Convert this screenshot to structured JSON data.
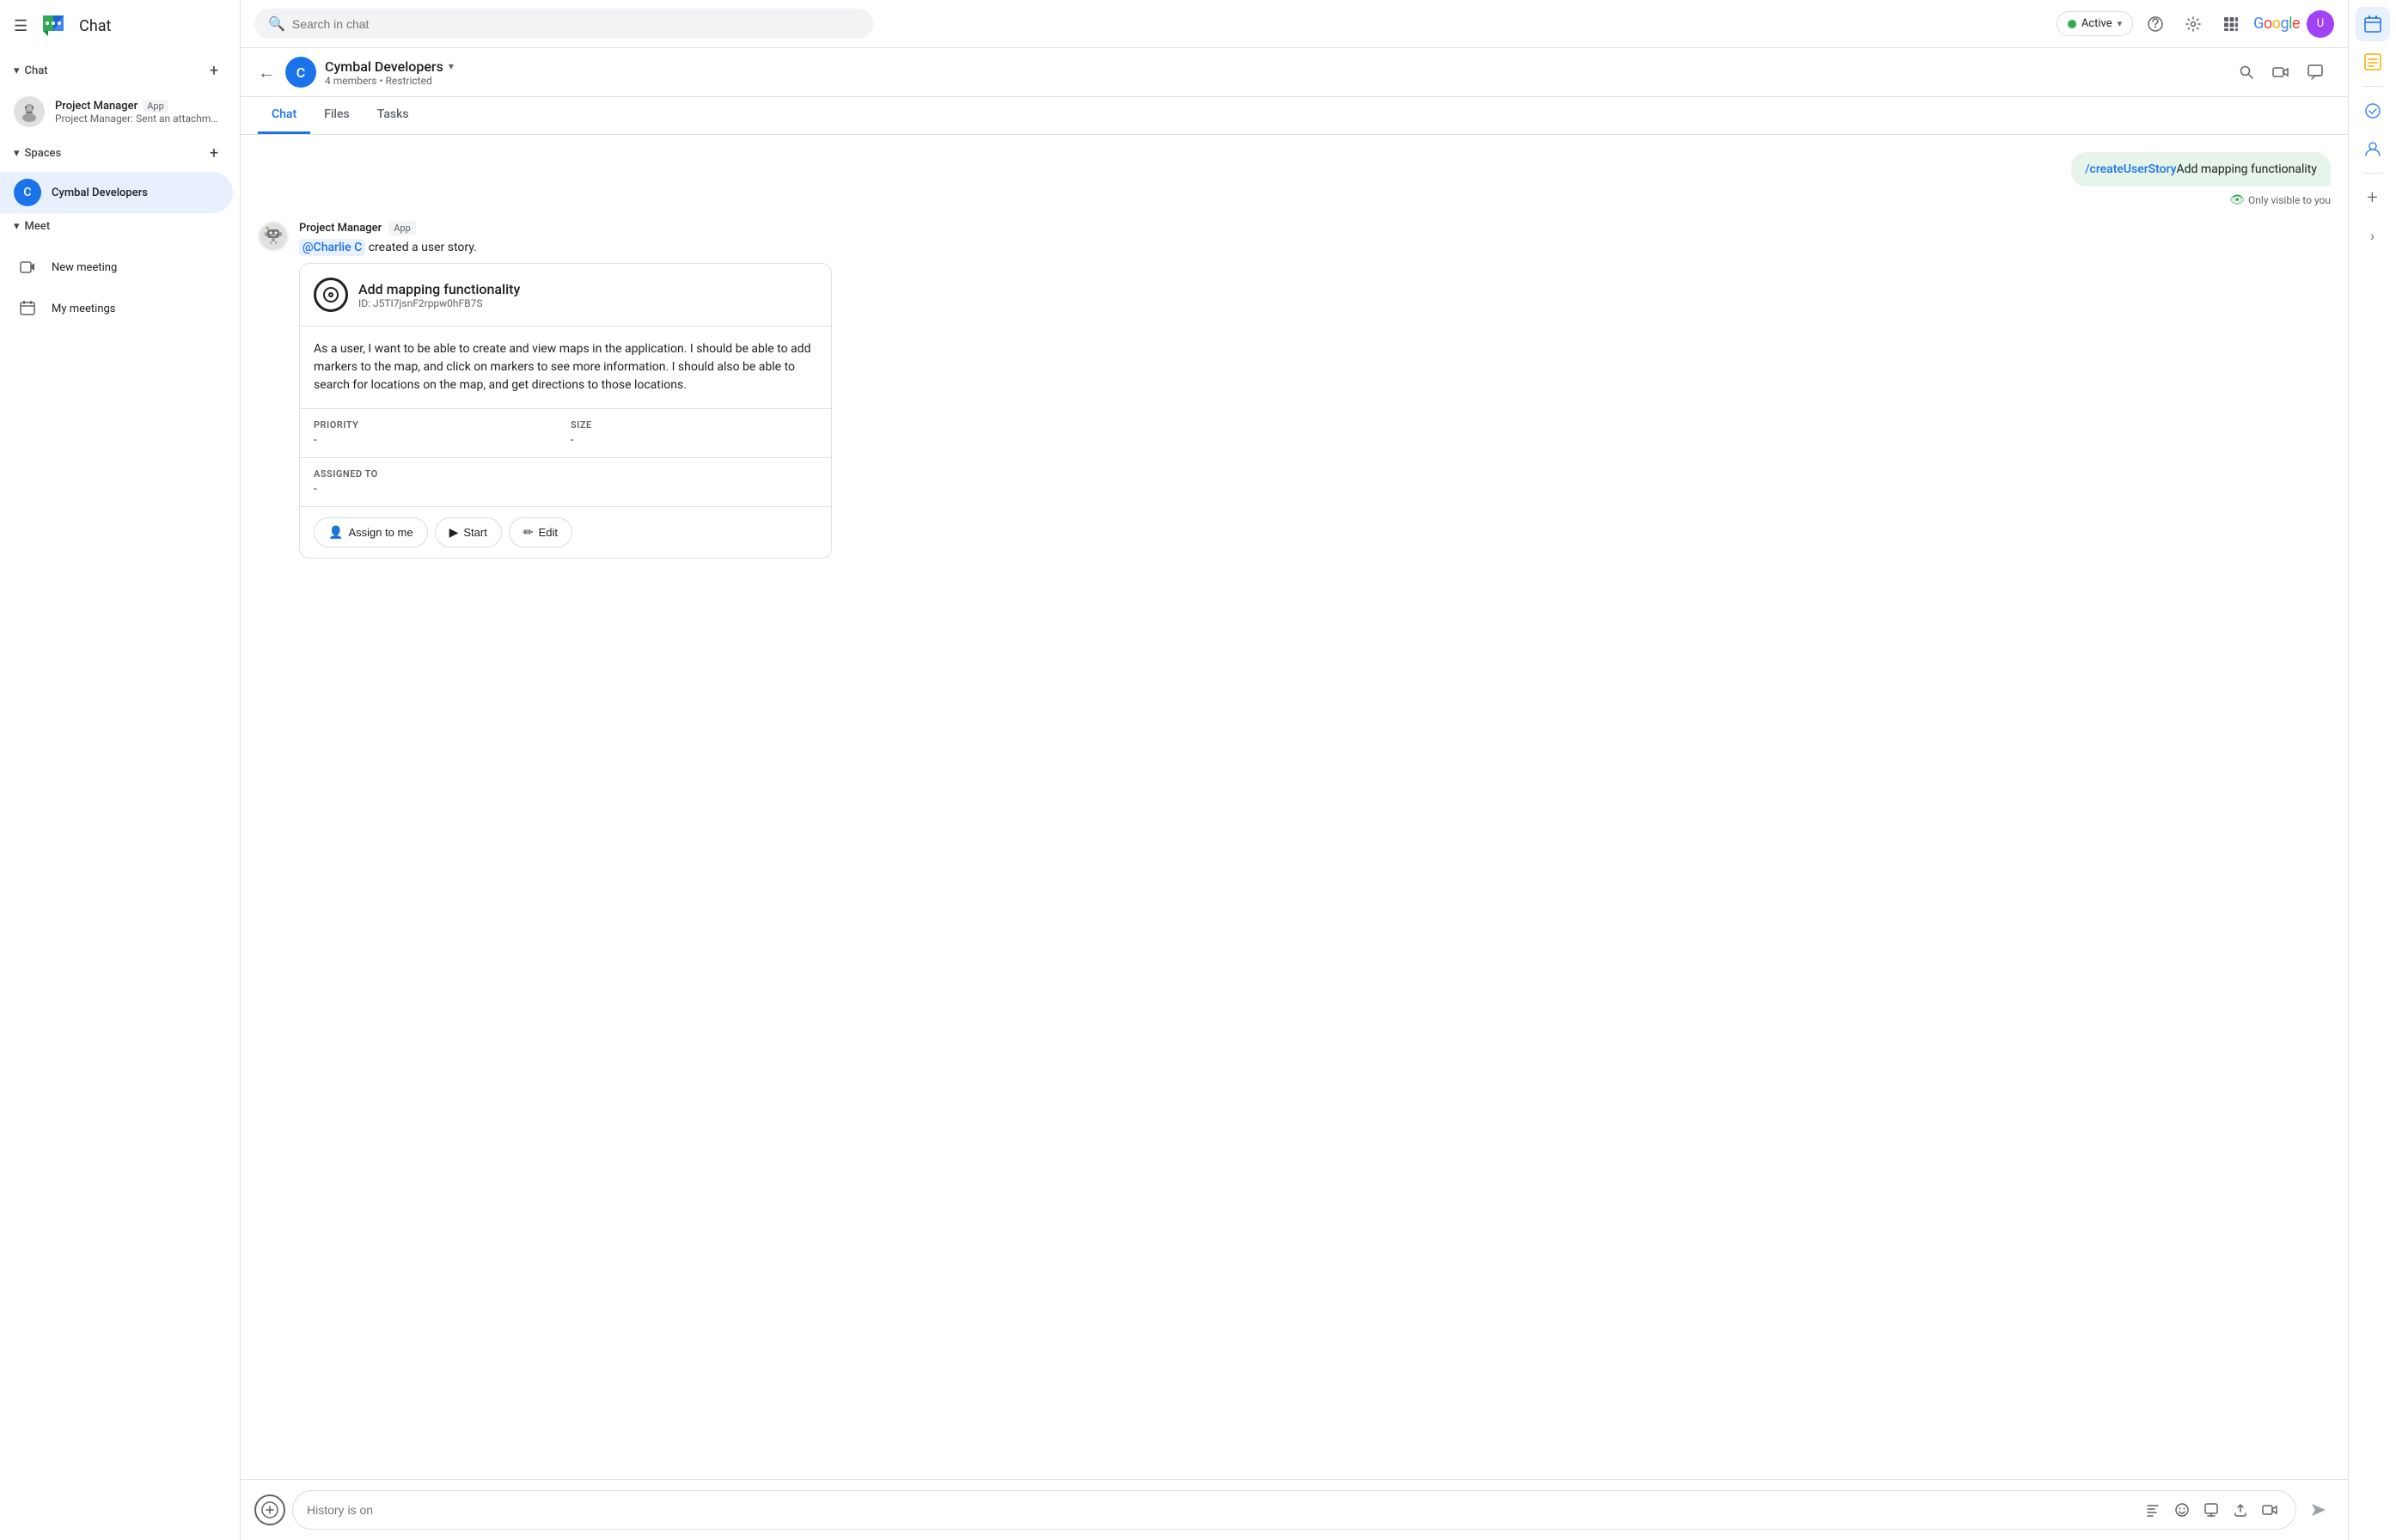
{
  "topbar": {
    "search_placeholder": "Search in chat",
    "status_label": "Active",
    "help_icon": "?",
    "settings_icon": "⚙",
    "apps_icon": "⋮⋮⋮",
    "google_label": "Google"
  },
  "sidebar": {
    "app_title": "Chat",
    "chat_section_label": "Chat",
    "chat_add_icon": "+",
    "spaces_section_label": "Spaces",
    "spaces_add_icon": "+",
    "meet_section_label": "Meet",
    "chat_items": [
      {
        "name": "Project Manager",
        "badge": "App",
        "sub": "Project Manager: Sent an attachment"
      }
    ],
    "space_items": [
      {
        "initial": "C",
        "name": "Cymbal Developers"
      }
    ],
    "meet_items": [
      {
        "label": "New meeting"
      },
      {
        "label": "My meetings"
      }
    ]
  },
  "chat_header": {
    "space_name": "Cymbal Developers",
    "members": "4 members",
    "restricted": "Restricted",
    "space_initial": "C",
    "dropdown_icon": "▾"
  },
  "tabs": [
    {
      "label": "Chat",
      "active": true
    },
    {
      "label": "Files",
      "active": false
    },
    {
      "label": "Tasks",
      "active": false
    }
  ],
  "messages": {
    "sent": {
      "command": "/createUserStory",
      "text": "Add mapping functionality",
      "visibility": "Only visible to you"
    },
    "bot": {
      "sender": "Project Manager",
      "badge": "App",
      "mention": "@Charlie C",
      "created_text": " created a user story.",
      "card": {
        "title": "Add mapping functionality",
        "id": "ID: J5TI7jsnF2rppw0hFB7S",
        "description": "As a user, I want to be able to create and view maps in the application. I should be able to add markers to the map, and click on markers to see more information. I should also be able to search for locations on the map, and get directions to those locations.",
        "priority_label": "PRIORITY",
        "priority_value": "-",
        "size_label": "SIZE",
        "size_value": "-",
        "assigned_label": "ASSIGNED TO",
        "assigned_value": "-",
        "buttons": [
          {
            "label": "Assign to me",
            "icon": "👤"
          },
          {
            "label": "Start",
            "icon": "▶"
          },
          {
            "label": "Edit",
            "icon": "✏"
          }
        ]
      }
    }
  },
  "input": {
    "placeholder": "History is on",
    "add_icon": "+",
    "format_icon": "A",
    "emoji_icon": "☺",
    "mention_icon": "⊡",
    "upload_icon": "⬆",
    "video_icon": "⊞",
    "send_icon": "➤"
  },
  "right_sidebar": {
    "icons": [
      {
        "name": "calendar-icon",
        "glyph": "📅",
        "active": true
      },
      {
        "name": "task-icon",
        "glyph": "☑",
        "active": false
      },
      {
        "name": "divider",
        "glyph": ""
      },
      {
        "name": "check-circle-icon",
        "glyph": "◎",
        "active": false
      },
      {
        "name": "person-icon",
        "glyph": "👤",
        "active": false
      },
      {
        "name": "divider2",
        "glyph": ""
      },
      {
        "name": "add-icon",
        "glyph": "+",
        "active": false
      }
    ]
  }
}
